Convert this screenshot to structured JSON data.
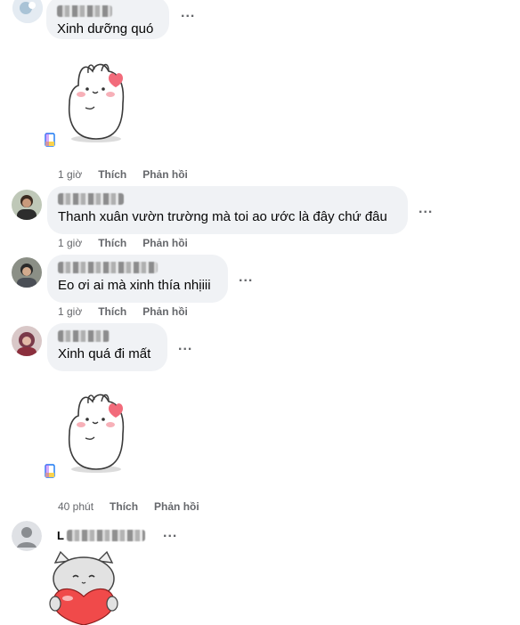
{
  "comments": [
    {
      "name_text": "",
      "text": "Xinh dưỡng quó",
      "time": "",
      "like": "",
      "reply": ""
    },
    {
      "name_text": "",
      "text": "",
      "time": "1 giờ",
      "like": "Thích",
      "reply": "Phản hồi"
    },
    {
      "name_text": "",
      "text": "Thanh xuân vườn trường mà toi ao ước là đây chứ đâu",
      "time": "1 giờ",
      "like": "Thích",
      "reply": "Phản hồi"
    },
    {
      "name_text": "",
      "text": "Eo ơi ai mà xinh thía nhịiii",
      "time": "1 giờ",
      "like": "Thích",
      "reply": "Phản hồi"
    },
    {
      "name_text": "",
      "text": "Xinh quá đi mất",
      "time": "",
      "like": "",
      "reply": ""
    },
    {
      "name_text": "L",
      "text": "",
      "time": "40 phút",
      "like": "Thích",
      "reply": "Phản hồi"
    }
  ],
  "more_label": "...",
  "icons": {
    "more": "more-options-icon",
    "sticker_bunny": "bunny-sticker",
    "sticker_cat_heart": "cat-heart-sticker",
    "file": "file-icon"
  },
  "colors": {
    "bubble": "#f0f2f5",
    "meta": "#65676b",
    "text": "#050505",
    "heart": "#f26b7b"
  }
}
